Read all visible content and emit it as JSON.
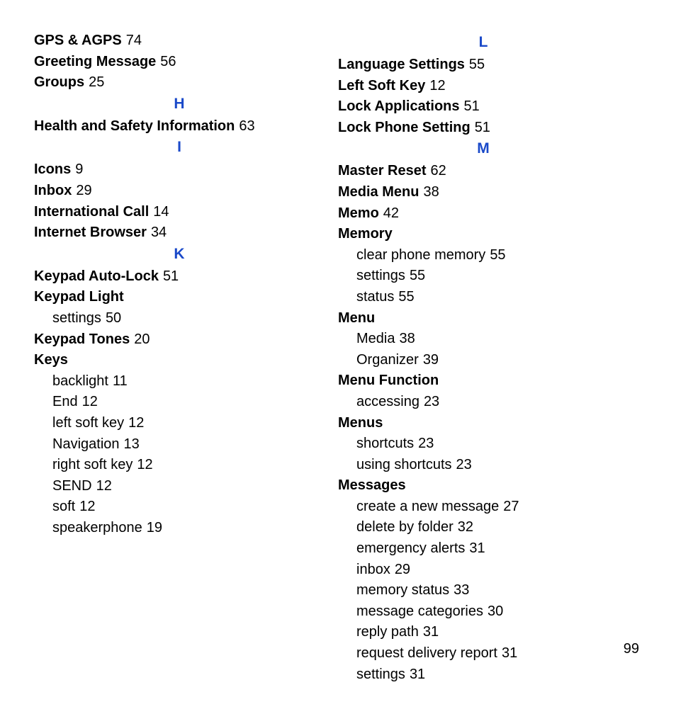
{
  "page_number": "99",
  "columns": [
    {
      "items": [
        {
          "type": "entry",
          "term": "GPS & AGPS",
          "page": "74"
        },
        {
          "type": "entry",
          "term": "Greeting Message",
          "page": "56"
        },
        {
          "type": "entry",
          "term": "Groups",
          "page": "25"
        },
        {
          "type": "letter",
          "text": "H"
        },
        {
          "type": "entry",
          "term": "Health and Safety Information",
          "page": "63"
        },
        {
          "type": "letter",
          "text": "I"
        },
        {
          "type": "entry",
          "term": "Icons",
          "page": "9"
        },
        {
          "type": "entry",
          "term": "Inbox",
          "page": "29"
        },
        {
          "type": "entry",
          "term": "International Call",
          "page": "14"
        },
        {
          "type": "entry",
          "term": "Internet Browser",
          "page": "34"
        },
        {
          "type": "letter",
          "text": "K"
        },
        {
          "type": "entry",
          "term": "Keypad Auto-Lock",
          "page": "51"
        },
        {
          "type": "heading",
          "term": "Keypad Light"
        },
        {
          "type": "sub",
          "text": "settings",
          "page": "50"
        },
        {
          "type": "entry",
          "term": "Keypad Tones",
          "page": "20"
        },
        {
          "type": "heading",
          "term": "Keys"
        },
        {
          "type": "sub",
          "text": "backlight",
          "page": "11"
        },
        {
          "type": "sub",
          "text": "End",
          "page": "12"
        },
        {
          "type": "sub",
          "text": "left soft key",
          "page": "12"
        },
        {
          "type": "sub",
          "text": "Navigation",
          "page": "13"
        },
        {
          "type": "sub",
          "text": "right soft key",
          "page": "12"
        },
        {
          "type": "sub",
          "text": "SEND",
          "page": "12"
        },
        {
          "type": "sub",
          "text": "soft",
          "page": "12"
        },
        {
          "type": "sub",
          "text": "speakerphone",
          "page": "19"
        }
      ]
    },
    {
      "items": [
        {
          "type": "letter",
          "text": "L"
        },
        {
          "type": "entry",
          "term": "Language Settings",
          "page": "55"
        },
        {
          "type": "entry",
          "term": "Left Soft Key",
          "page": "12"
        },
        {
          "type": "entry",
          "term": "Lock Applications",
          "page": "51"
        },
        {
          "type": "entry",
          "term": "Lock Phone Setting",
          "page": "51"
        },
        {
          "type": "letter",
          "text": "M"
        },
        {
          "type": "entry",
          "term": "Master Reset",
          "page": "62"
        },
        {
          "type": "entry",
          "term": "Media Menu",
          "page": "38"
        },
        {
          "type": "entry",
          "term": "Memo",
          "page": "42"
        },
        {
          "type": "heading",
          "term": "Memory"
        },
        {
          "type": "sub",
          "text": "clear phone memory",
          "page": "55"
        },
        {
          "type": "sub",
          "text": "settings",
          "page": "55"
        },
        {
          "type": "sub",
          "text": "status",
          "page": "55"
        },
        {
          "type": "heading",
          "term": "Menu"
        },
        {
          "type": "sub",
          "text": "Media",
          "page": "38"
        },
        {
          "type": "sub",
          "text": "Organizer",
          "page": "39"
        },
        {
          "type": "heading",
          "term": "Menu Function"
        },
        {
          "type": "sub",
          "text": "accessing",
          "page": "23"
        },
        {
          "type": "heading",
          "term": "Menus"
        },
        {
          "type": "sub",
          "text": "shortcuts",
          "page": "23"
        },
        {
          "type": "sub",
          "text": "using shortcuts",
          "page": "23"
        },
        {
          "type": "heading",
          "term": "Messages"
        },
        {
          "type": "sub",
          "text": "create a new message",
          "page": "27"
        },
        {
          "type": "sub",
          "text": "delete by folder",
          "page": "32"
        },
        {
          "type": "sub",
          "text": "emergency alerts",
          "page": "31"
        },
        {
          "type": "sub",
          "text": "inbox",
          "page": "29"
        },
        {
          "type": "sub",
          "text": "memory status",
          "page": "33"
        },
        {
          "type": "sub",
          "text": "message categories",
          "page": "30"
        },
        {
          "type": "sub",
          "text": "reply path",
          "page": "31"
        },
        {
          "type": "sub",
          "text": "request delivery report",
          "page": "31"
        },
        {
          "type": "sub",
          "text": "settings",
          "page": "31"
        }
      ]
    }
  ]
}
